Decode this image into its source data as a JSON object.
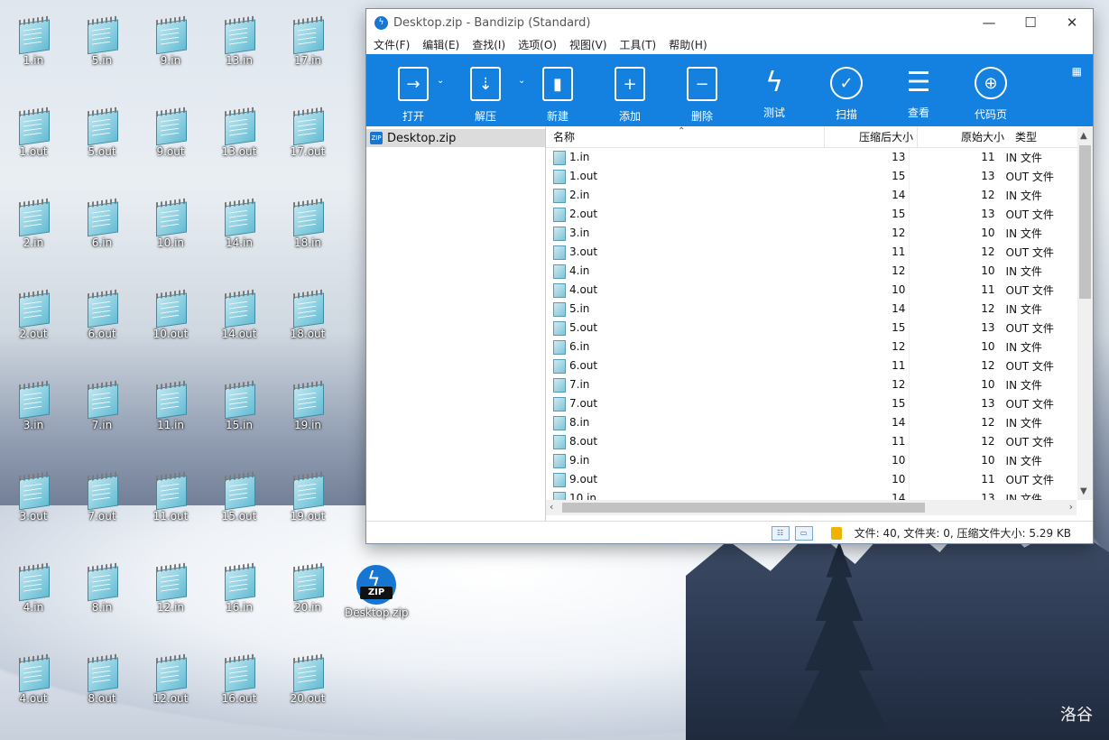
{
  "desktop": {
    "watermark": "洛谷",
    "zip_icon_label": "Desktop.zip",
    "zip_badge": "ZIP",
    "icon_columns": [
      [
        "1.in",
        "1.out",
        "2.in",
        "2.out",
        "3.in",
        "3.out",
        "4.in",
        "4.out"
      ],
      [
        "5.in",
        "5.out",
        "6.in",
        "6.out",
        "7.in",
        "7.out",
        "8.in",
        "8.out"
      ],
      [
        "9.in",
        "9.out",
        "10.in",
        "10.out",
        "11.in",
        "11.out",
        "12.in",
        "12.out"
      ],
      [
        "13.in",
        "13.out",
        "14.in",
        "14.out",
        "15.in",
        "15.out",
        "16.in",
        "16.out"
      ],
      [
        "17.in",
        "17.out",
        "18.in",
        "18.out",
        "19.in",
        "19.out",
        "20.in",
        "20.out"
      ]
    ]
  },
  "window": {
    "title": "Desktop.zip - Bandizip (Standard)",
    "controls": {
      "minimize": "—",
      "maximize": "☐",
      "close": "✕"
    },
    "menu": [
      "文件(F)",
      "编辑(E)",
      "查找(I)",
      "选项(O)",
      "视图(V)",
      "工具(T)",
      "帮助(H)"
    ],
    "toolbar": [
      {
        "label": "打开",
        "icon": "open-icon",
        "glyph": "→"
      },
      {
        "label": "解压",
        "icon": "extract-icon",
        "glyph": "⇣"
      },
      {
        "label": "新建",
        "icon": "new-archive-icon",
        "glyph": "▮"
      },
      {
        "label": "添加",
        "icon": "add-icon",
        "glyph": "+"
      },
      {
        "label": "删除",
        "icon": "delete-icon",
        "glyph": "−"
      },
      {
        "label": "测试",
        "icon": "test-icon",
        "glyph": "ϟ"
      },
      {
        "label": "扫描",
        "icon": "scan-icon",
        "glyph": "✓"
      },
      {
        "label": "查看",
        "icon": "view-icon",
        "glyph": "☰"
      },
      {
        "label": "代码页",
        "icon": "codepage-icon",
        "glyph": "⊕"
      }
    ],
    "tree_item": "Desktop.zip",
    "columns": {
      "name": "名称",
      "compressed": "压缩后大小",
      "original": "原始大小",
      "type": "类型"
    },
    "files": [
      {
        "name": "1.in",
        "compressed": "13",
        "original": "11",
        "type": "IN 文件"
      },
      {
        "name": "1.out",
        "compressed": "15",
        "original": "13",
        "type": "OUT 文件"
      },
      {
        "name": "2.in",
        "compressed": "14",
        "original": "12",
        "type": "IN 文件"
      },
      {
        "name": "2.out",
        "compressed": "15",
        "original": "13",
        "type": "OUT 文件"
      },
      {
        "name": "3.in",
        "compressed": "12",
        "original": "10",
        "type": "IN 文件"
      },
      {
        "name": "3.out",
        "compressed": "11",
        "original": "12",
        "type": "OUT 文件"
      },
      {
        "name": "4.in",
        "compressed": "12",
        "original": "10",
        "type": "IN 文件"
      },
      {
        "name": "4.out",
        "compressed": "10",
        "original": "11",
        "type": "OUT 文件"
      },
      {
        "name": "5.in",
        "compressed": "14",
        "original": "12",
        "type": "IN 文件"
      },
      {
        "name": "5.out",
        "compressed": "15",
        "original": "13",
        "type": "OUT 文件"
      },
      {
        "name": "6.in",
        "compressed": "12",
        "original": "10",
        "type": "IN 文件"
      },
      {
        "name": "6.out",
        "compressed": "11",
        "original": "12",
        "type": "OUT 文件"
      },
      {
        "name": "7.in",
        "compressed": "12",
        "original": "10",
        "type": "IN 文件"
      },
      {
        "name": "7.out",
        "compressed": "15",
        "original": "13",
        "type": "OUT 文件"
      },
      {
        "name": "8.in",
        "compressed": "14",
        "original": "12",
        "type": "IN 文件"
      },
      {
        "name": "8.out",
        "compressed": "11",
        "original": "12",
        "type": "OUT 文件"
      },
      {
        "name": "9.in",
        "compressed": "10",
        "original": "10",
        "type": "IN 文件"
      },
      {
        "name": "9.out",
        "compressed": "10",
        "original": "11",
        "type": "OUT 文件"
      },
      {
        "name": "10.in",
        "compressed": "14",
        "original": "13",
        "type": "IN 文件"
      }
    ],
    "status": "文件: 40, 文件夹: 0, 压缩文件大小: 5.29 KB"
  }
}
